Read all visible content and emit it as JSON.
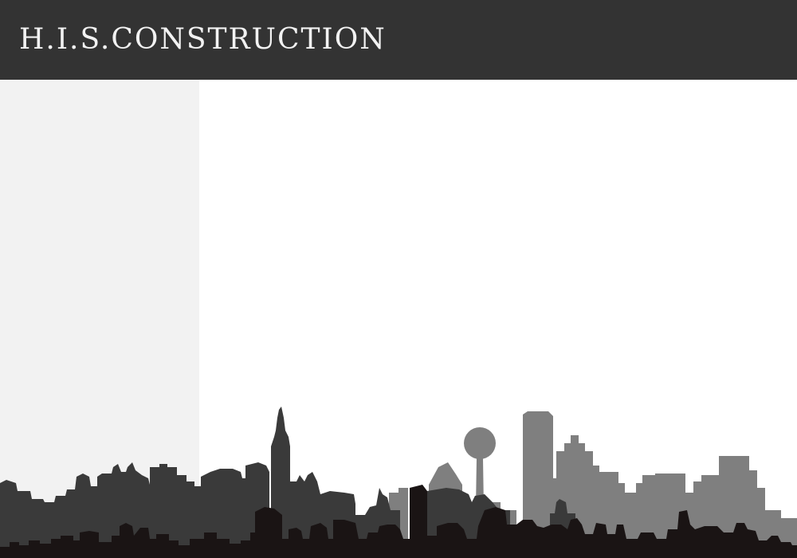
{
  "header": {
    "logo_text": "H.I.S.CONSTRUCTION"
  },
  "colors": {
    "header_bg": "#333333",
    "logo_text": "#f2f2f2",
    "sidebar_bg": "#f2f2f2",
    "main_bg": "#ffffff",
    "skyline_back": "#7f7f7f",
    "skyline_mid": "#3a3a3a",
    "skyline_front": "#1a1414"
  },
  "images": {
    "skyline": "city-skyline-silhouette"
  }
}
